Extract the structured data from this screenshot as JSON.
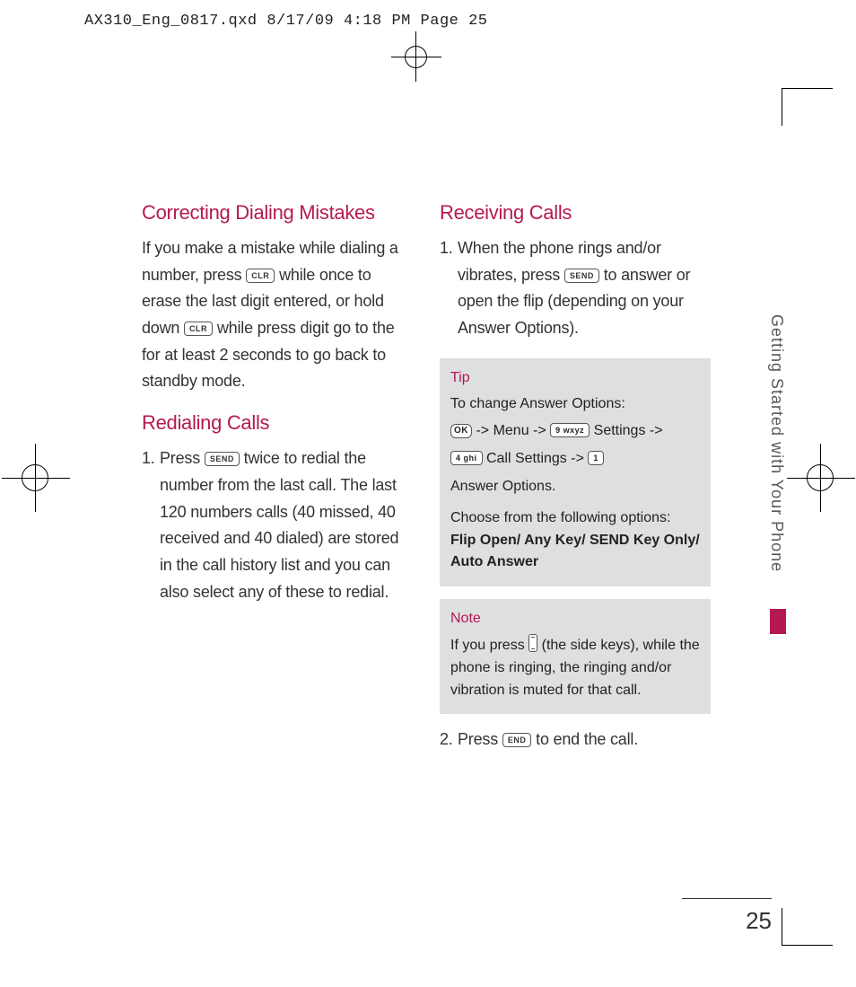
{
  "header": {
    "slug": "AX310_Eng_0817.qxd  8/17/09  4:18 PM  Page 25"
  },
  "left": {
    "h1": "Correcting Dialing Mistakes",
    "p1a": "If you make a mistake while dialing a number, press ",
    "p1b": " while once to erase the last digit entered, or hold down ",
    "p1c": " while press digit go to the for at least 2 seconds to go back to standby mode.",
    "h2": "Redialing Calls",
    "l1n": "1.",
    "l1a": "Press ",
    "l1b": " twice to redial the number from the last call. The last 120 numbers calls (40 missed, 40 received and 40 dialed) are stored in the call history list and you can also select any of these to redial."
  },
  "right": {
    "h1": "Receiving Calls",
    "l1n": "1.",
    "l1a": "When the phone rings and/or vibrates, press ",
    "l1b": " to answer or open the flip (depending on your Answer Options).",
    "tip_title": "Tip",
    "tip_l1": "To change Answer Options:",
    "tip_menu": "Menu",
    "tip_settings": "Settings",
    "tip_callsettings": "Call Settings",
    "tip_answeropts": "Answer Options",
    "tip_choose": "Choose from the following options:",
    "tip_opts": "Flip Open/ Any Key/ SEND Key Only/ Auto Answer",
    "note_title": "Note",
    "note_a": "If you press ",
    "note_b": " (the side keys), while the phone is ringing, the ringing and/or vibration is muted for that call.",
    "l2n": "2.",
    "l2a": "Press ",
    "l2b": " to end the call."
  },
  "keys": {
    "clr": "CLR",
    "send": "SEND",
    "ok": "OK",
    "nine": "9 wxyz",
    "four": "4 ghi",
    "one": "1",
    "end": "END"
  },
  "side": {
    "label": "Getting Started with Your Phone"
  },
  "page": {
    "num": "25"
  }
}
